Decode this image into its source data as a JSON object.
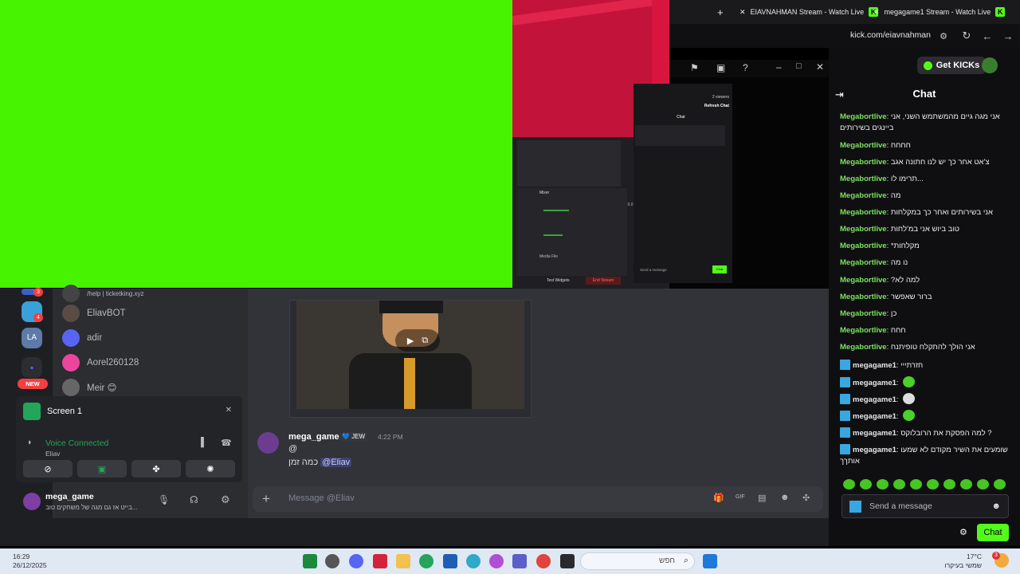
{
  "browser": {
    "tabs": [
      {
        "label": "EIAVNAHMAN Stream - Watch Live"
      },
      {
        "label": "megagame1 Stream - Watch Live"
      }
    ],
    "new_tab": "+",
    "url": "kick.com/eiavnahman"
  },
  "kick": {
    "get_kicks": "Get KICKs",
    "chat_title": "Chat",
    "messages": [
      {
        "user": "Megabortlive",
        "text": "אני מגה גיים מהמשתמש השני, אני ביינגים בשירותים"
      },
      {
        "user": "Megabortlive",
        "text": "חחחח"
      },
      {
        "user": "Megabortlive",
        "text": "צ'אט אחר כך יש לנו חתונה אגב"
      },
      {
        "user": "Megabortlive",
        "text": "תרימו לו..."
      },
      {
        "user": "Megabortlive",
        "text": "מה"
      },
      {
        "user": "Megabortlive",
        "text": "אני בשירותים ואחר כך במקלחות"
      },
      {
        "user": "Megabortlive",
        "text": "טוב ביוש אני במ'לחות"
      },
      {
        "user": "Megabortlive",
        "text": "*מקלחות"
      },
      {
        "user": "Megabortlive",
        "text": "נו מה"
      },
      {
        "user": "Megabortlive",
        "text": "?למה לא"
      },
      {
        "user": "Megabortlive",
        "text": "ברור שאפשר"
      },
      {
        "user": "Megabortlive",
        "text": "כן"
      },
      {
        "user": "Megabortlive",
        "text": "חחח"
      },
      {
        "user": "Megabortlive",
        "text": "אני הולך להתקלח טופיתנח"
      }
    ],
    "messages2": [
      {
        "user": "megagame1",
        "text": "חזרתייי"
      },
      {
        "user": "megagame1",
        "text": ""
      },
      {
        "user": "megagame1",
        "text": ""
      },
      {
        "user": "megagame1",
        "text": ""
      },
      {
        "user": "megagame1",
        "text": "למה הפסקת את הרובלוקס ?"
      },
      {
        "user": "megagame1",
        "text": "שומעים את השיר מקודם לא שמעו אותךך"
      }
    ],
    "send_placeholder": "Send a message",
    "chat_button": "Chat"
  },
  "discord": {
    "dms": [
      {
        "name": "/help | ticketking.xyz"
      },
      {
        "name": "EliavBOT"
      },
      {
        "name": "adir"
      },
      {
        "name": "Aorel260128"
      },
      {
        "name": "Meir 😊"
      }
    ],
    "server_badges": [
      "3",
      "4",
      "4"
    ],
    "new_badge": "NEW",
    "screen_share": "Screen 1",
    "voice_status": "Voice Connected",
    "voice_channel": "Eliav",
    "user_name": "mega_game",
    "user_status": "בייט אז גם מגה של משחקים טוב...",
    "message": {
      "author": "mega_game",
      "tag": "JEW",
      "time": "4:22 PM",
      "line1": "@",
      "line2_text": "כמה זמן",
      "mention": "@Eliav"
    },
    "input_placeholder": "Message @Eliav"
  },
  "obs": {
    "viewers": "2 viewers",
    "refresh_chat": "Refresh Chat",
    "chat": "Chat",
    "mixer": "Mixer",
    "media_file": "Media File",
    "db1": "0.0 dB",
    "test_widgets": "Test Widgets",
    "end_stream": "End Stream",
    "send_a_message": "Send a message",
    "chat_btn": "Chat"
  },
  "taskbar": {
    "time": "16:29",
    "date": "26/12/2025",
    "search": "חפש",
    "temp": "17°C",
    "weather": "שמשי בעיקרו",
    "notif": "3"
  },
  "colors": {
    "green_screen": "#48f300",
    "kick_green": "#53fc18",
    "kick_username": "#7de35d",
    "discord_bg": "#313338",
    "voice_green": "#23a55a"
  }
}
